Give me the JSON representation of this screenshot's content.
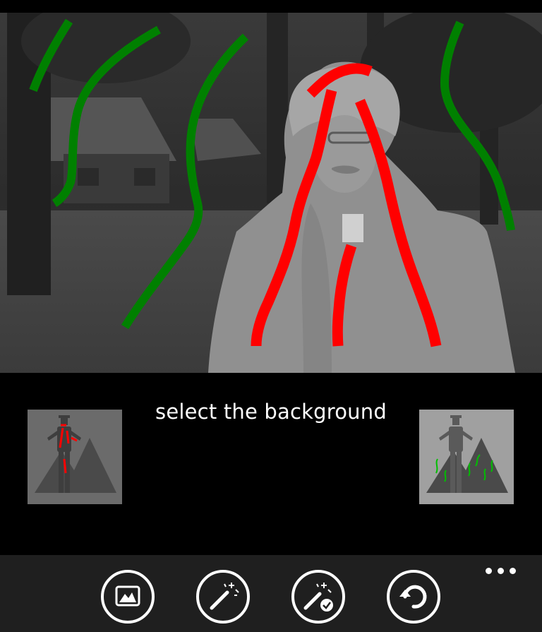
{
  "instruction": "select the background",
  "colors": {
    "background_stroke": "#008000",
    "foreground_stroke": "#ff0000",
    "app_bar": "#1f1f1f",
    "page": "#000000"
  },
  "mode_buttons": {
    "foreground": {
      "icon": "mark-foreground-icon",
      "selected": false
    },
    "background": {
      "icon": "mark-background-icon",
      "selected": true
    }
  },
  "app_bar": {
    "buttons": [
      {
        "icon": "picture-icon"
      },
      {
        "icon": "magic-wand-icon"
      },
      {
        "icon": "magic-wand-apply-icon"
      },
      {
        "icon": "undo-icon"
      }
    ],
    "more_icon": "more-dots-icon"
  }
}
